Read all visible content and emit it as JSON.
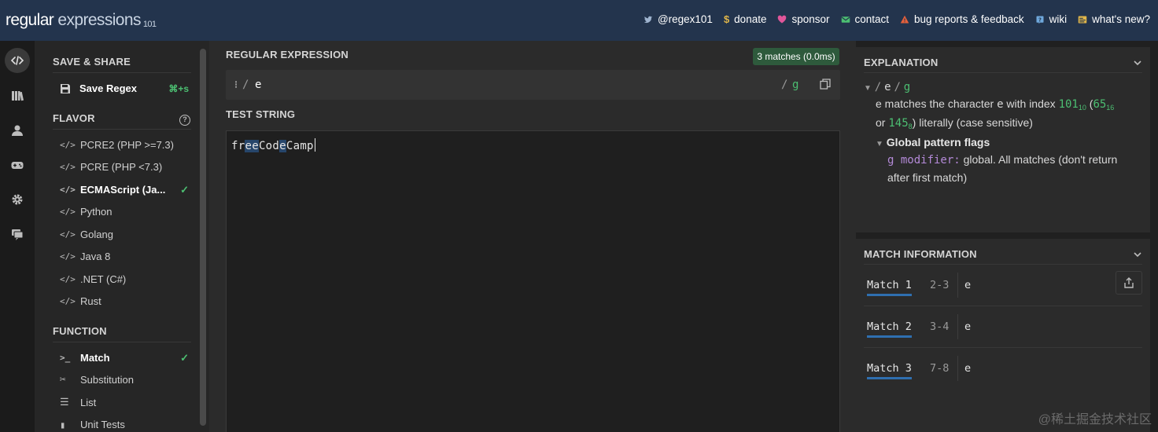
{
  "header": {
    "logo_main": "regular",
    "logo_sub": " expressions",
    "logo_version": "101",
    "nav": [
      {
        "label": "@regex101",
        "icon": "twitter-icon"
      },
      {
        "label": "donate",
        "icon": "dollar-icon"
      },
      {
        "label": "sponsor",
        "icon": "heart-icon"
      },
      {
        "label": "contact",
        "icon": "mail-icon"
      },
      {
        "label": "bug reports & feedback",
        "icon": "warning-icon"
      },
      {
        "label": "wiki",
        "icon": "book-icon"
      },
      {
        "label": "what's new?",
        "icon": "news-icon"
      }
    ]
  },
  "sidebar": {
    "save_share": {
      "title": "SAVE & SHARE",
      "save_label": "Save Regex",
      "save_shortcut": "⌘+s"
    },
    "flavor": {
      "title": "FLAVOR",
      "items": [
        {
          "label": "PCRE2 (PHP >=7.3)",
          "selected": false
        },
        {
          "label": "PCRE (PHP <7.3)",
          "selected": false
        },
        {
          "label": "ECMAScript (Ja...",
          "selected": true
        },
        {
          "label": "Python",
          "selected": false
        },
        {
          "label": "Golang",
          "selected": false
        },
        {
          "label": "Java 8",
          "selected": false
        },
        {
          "label": ".NET (C#)",
          "selected": false
        },
        {
          "label": "Rust",
          "selected": false
        }
      ]
    },
    "function": {
      "title": "FUNCTION",
      "items": [
        {
          "label": "Match",
          "selected": true
        },
        {
          "label": "Substitution",
          "selected": false
        },
        {
          "label": "List",
          "selected": false
        },
        {
          "label": "Unit Tests",
          "selected": false
        }
      ]
    }
  },
  "editor": {
    "regex_title": "REGULAR EXPRESSION",
    "match_badge": "3 matches (0.0ms)",
    "open_delim": "/",
    "pattern": "e",
    "close_delim": "/",
    "flags": "g",
    "test_title": "TEST STRING",
    "test_segments": [
      {
        "text": "fr",
        "hl": false
      },
      {
        "text": "e",
        "hl": true
      },
      {
        "text": "e",
        "hl": true
      },
      {
        "text": "Cod",
        "hl": false
      },
      {
        "text": "e",
        "hl": true
      },
      {
        "text": "Camp",
        "hl": false
      }
    ]
  },
  "explanation": {
    "title": "EXPLANATION",
    "regex_line": {
      "slash1": "/",
      "pattern": "e",
      "slash2": "/",
      "flags": "g"
    },
    "line1_a": "e matches the character ",
    "line1_char": "e",
    "line1_b": " with index ",
    "idx10": "101",
    "sub10": "10",
    "paren_open": " (",
    "idx16": "65",
    "sub16": "16",
    "line2_a": "or ",
    "idx8": "145",
    "sub8": "8",
    "line2_b": ") literally (case sensitive)",
    "flags_title": "Global pattern flags",
    "flag_code": "g modifier:",
    "flag_desc_1": " global. All matches (don't return",
    "flag_desc_2": "after first match)"
  },
  "match_info": {
    "title": "MATCH INFORMATION",
    "matches": [
      {
        "label": "Match 1",
        "range": "2-3",
        "value": "e"
      },
      {
        "label": "Match 2",
        "range": "3-4",
        "value": "e"
      },
      {
        "label": "Match 3",
        "range": "7-8",
        "value": "e"
      }
    ]
  },
  "watermark": "@稀土掘金技术社区",
  "colors": {
    "header_bg": "#23344d",
    "accent_green": "#4cbf72",
    "match_highlight": "#27466b",
    "match_underline": "#2f6fb0"
  }
}
